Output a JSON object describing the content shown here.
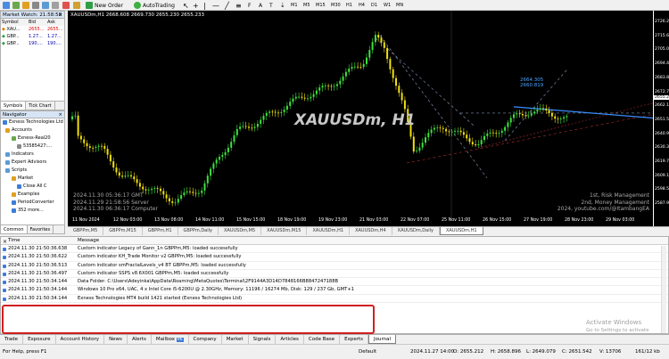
{
  "toolbar": {
    "new_order": "New Order",
    "autotrading": "AutoTrading"
  },
  "market_watch": {
    "title": "Market Watch: 21:58:58",
    "columns": [
      "Symbol",
      "Bid",
      "Ask"
    ],
    "rows": [
      {
        "symbol": "XAU...",
        "bid": "2655...",
        "ask": "2655..."
      },
      {
        "symbol": "GBP...",
        "bid": "1.27...",
        "ask": "1.27..."
      },
      {
        "symbol": "GBP...",
        "bid": "190....",
        "ask": "190...."
      }
    ],
    "tabs": [
      "Symbols",
      "Tick Chart"
    ]
  },
  "navigator": {
    "title": "Navigator",
    "items": [
      "Exness Technologies Ltd",
      "Accounts",
      "Exness-Real20",
      "53585427:...",
      "Indicators",
      "Expert Advisors",
      "Scripts",
      "Market",
      "Close All C",
      "Examples",
      "PeriodConverter",
      "352 more..."
    ],
    "tabs": [
      "Common",
      "Favorites"
    ]
  },
  "chart": {
    "header": "XAUUSDm,H1  2668.608 2669.730 2655.230 2655.233",
    "symbol_label": "XAUUSDm, H1",
    "info_lines": [
      "2024.11.30 05:36:17 GMT",
      "2024.11.29 21:58:56 Server",
      "2024.11.30 06:36:17 Computer"
    ],
    "brand_lines": [
      "1st, Risk Management",
      "2nd, Money Management",
      "2024, youtube.com/@ItambangEA"
    ],
    "label_upper": "2664.305",
    "label_lower": "2660.819",
    "price_labels": [
      "2726.230",
      "2715.630",
      "2705.030",
      "2694.430",
      "2683.830",
      "2672.725",
      "2662.125",
      "2651.525",
      "2640.925",
      "2630.325",
      "2619.720",
      "2609.120",
      "2598.520",
      "2587.920"
    ],
    "current_price": "2655.233",
    "time_labels": [
      "11 Nov 2024",
      "12 Nov 03:00",
      "13 Nov 08:00",
      "14 Nov 11:00",
      "15 Nov 15:00",
      "18 Nov 19:00",
      "19 Nov 23:00",
      "21 Nov 03:00",
      "22 Nov 07:00",
      "25 Nov 11:00",
      "26 Nov 15:00",
      "27 Nov 19:00",
      "28 Nov 23:00",
      "29 Nov 03:00"
    ],
    "colors": {
      "bull": "#3ee13e",
      "bear": "#f0e010",
      "bg": "#000000"
    }
  },
  "chart_tabs": [
    "GBPPm,M5",
    "GBPPm,M15",
    "GBPPm,H1",
    "GBPPm,Daily",
    "XAUUSDm,M5",
    "XAUUSDm,M15",
    "XAUUSDm,H1",
    "XAUUSDm,H4",
    "XAUUSDm,Daily",
    "XAUUSDm,H1"
  ],
  "terminal": {
    "columns": [
      "Time",
      "Message"
    ],
    "rows": [
      {
        "time": "2024.11.30 21:50:36.638",
        "msg": "Custom indicator Legacy of Gann_1n GBPPm,M5: loaded successfully"
      },
      {
        "time": "2024.11.30 21:50:36.622",
        "msg": "Custom indicator KH_Trade Monitor v2 GBPPm,M5: loaded successfully"
      },
      {
        "time": "2024.11.30 21:50:36.513",
        "msg": "Custom indicator smFractalLevels_v4 BT GBPPm,M5: loaded successfully"
      },
      {
        "time": "2024.11.30 21:50:36.497",
        "msg": "Custom indicator SSPS v8.6X001 GBPPm,M5: loaded successfully"
      },
      {
        "time": "2024.11.30 21:50:34.144",
        "msg": "Data Folder: C:\\Users\\Adeyinka\\AppData\\Roaming\\MetaQuotes\\Terminal\\2F9144A3D14D7848166B8847247188B"
      },
      {
        "time": "2024.11.30 21:50:34.144",
        "msg": "Windows 10 Pro x64, UAC, 4 x Intel Core i5-6200U @ 2.30GHz, Memory: 11196 / 16274 Mb, Disk: 129 / 237 Gb, GMT+1"
      },
      {
        "time": "2024.11.30 21:50:34.144",
        "msg": "Exness Technologies MT4 build 1421 started (Exness Technologies Ltd)"
      }
    ],
    "tabs": [
      "Trade",
      "Exposure",
      "Account History",
      "News",
      "Alerts",
      "Mailbox",
      "Company",
      "Market",
      "Signals",
      "Articles",
      "Code Base",
      "Experts",
      "Journal"
    ],
    "mailbox_count": "96"
  },
  "watermark": [
    "Activate Windows",
    "Go to Settings to activate Windows."
  ],
  "status": {
    "help": "For Help, press F1",
    "profile": "Default",
    "time": "2024.11.27 14:00",
    "o": "O: 2655.212",
    "h": "H: 2658.896",
    "l": "L: 2649.079",
    "c": "C: 2651.542",
    "v": "V: 13706",
    "conn": "161/12 kb"
  }
}
